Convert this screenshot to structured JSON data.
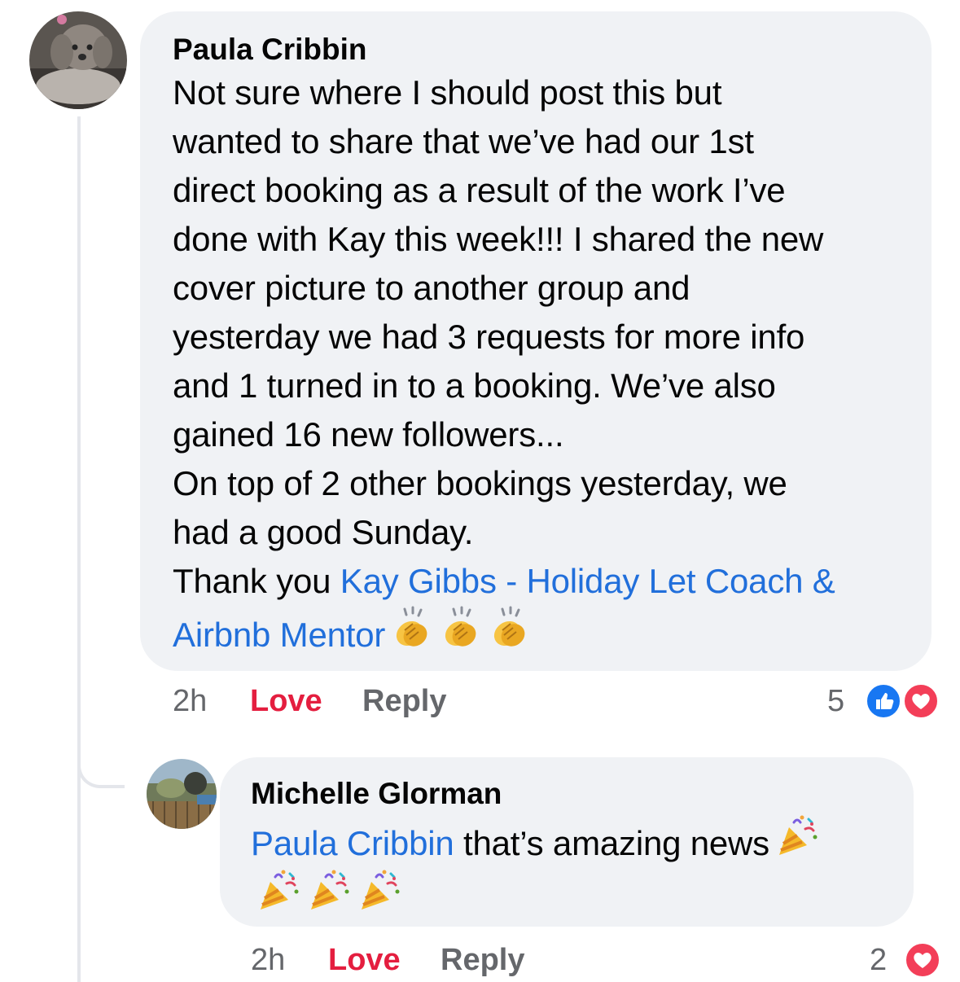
{
  "comments": [
    {
      "author": "Paula Cribbin",
      "body_lines": [
        "Not sure where I should post this but",
        "wanted to share that we’ve had our 1st",
        "direct booking as a result of the work I’ve",
        "done with Kay this week!!! I shared the new",
        "cover picture to another group and",
        "yesterday we had 3 requests for more info",
        "and 1 turned in to a booking. We’ve also",
        "gained 16 new followers...",
        "On top of 2 other bookings yesterday, we",
        "had a good Sunday."
      ],
      "thanks_prefix": "Thank you ",
      "mention_line1": "Kay Gibbs - Holiday Let Coach &",
      "mention_line2": "Airbnb Mentor",
      "emoji": "clapping-hands-emoji",
      "emoji_count": 3,
      "time": "2h",
      "love_label": "Love",
      "reply_label": "Reply",
      "reaction_count": "5",
      "reactions": [
        "like",
        "love"
      ]
    },
    {
      "author": "Michelle Glorman",
      "mention": "Paula Cribbin",
      "body_text": " that’s amazing news",
      "emoji": "party-popper-emoji",
      "emoji_count": 4,
      "time": "2h",
      "love_label": "Love",
      "reply_label": "Reply",
      "reaction_count": "2",
      "reactions": [
        "love"
      ]
    }
  ],
  "colors": {
    "bubble": "#f0f2f5",
    "mention": "#216fdb",
    "love": "#e41e3f",
    "muted": "#65676b",
    "like_blue": "#1877f2"
  }
}
